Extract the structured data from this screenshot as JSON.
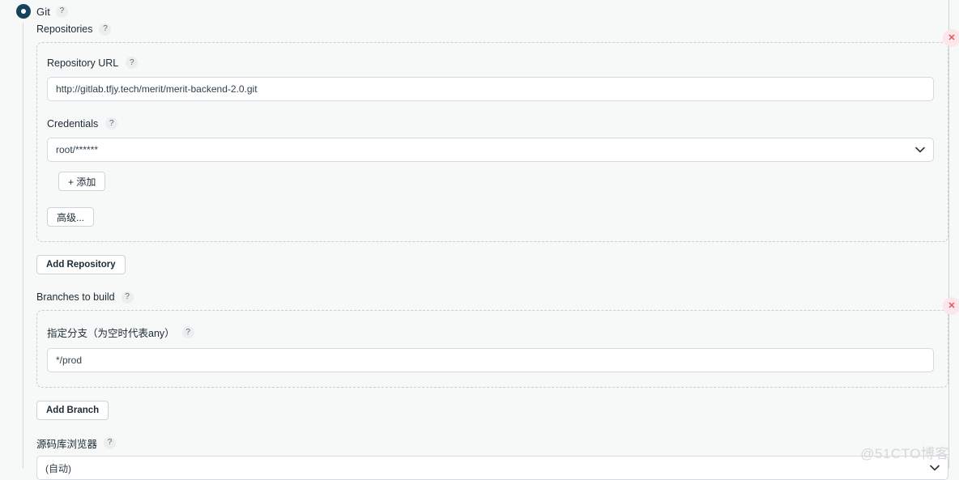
{
  "scm": {
    "radio_label": "Git",
    "radio_selected": true,
    "help_glyph": "?"
  },
  "repositories": {
    "section_label": "Repositories",
    "entries": [
      {
        "url_label": "Repository URL",
        "url_value": "http://gitlab.tfjy.tech/merit/merit-backend-2.0.git",
        "credentials_label": "Credentials",
        "credentials_value": "root/******",
        "add_credential_label": "+ 添加",
        "advanced_label": "高级...",
        "delete_label": "✕"
      }
    ],
    "add_repository_label": "Add Repository"
  },
  "branches": {
    "section_label": "Branches to build",
    "entries": [
      {
        "label": "指定分支（为空时代表any）",
        "value": "*/prod",
        "delete_label": "✕"
      }
    ],
    "add_branch_label": "Add Branch"
  },
  "browser": {
    "label": "源码库浏览器",
    "value": "(自动)"
  },
  "watermark": {
    "text": "@51CTO博客"
  },
  "colors": {
    "radio_fill": "#16425b",
    "delete_bg": "#fbe7e9",
    "delete_fg": "#e0555f",
    "page_bg": "#f7f8f8",
    "dashed_border": "#c7ced4"
  }
}
